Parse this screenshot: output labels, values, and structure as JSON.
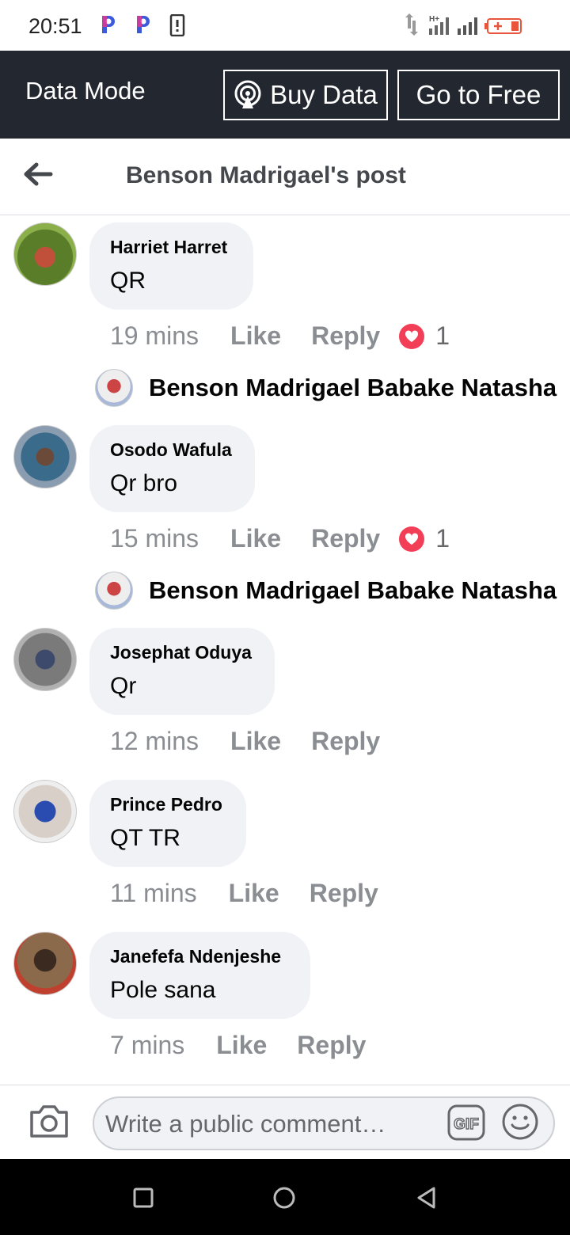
{
  "status_bar": {
    "time": "20:51"
  },
  "data_bar": {
    "label": "Data Mode",
    "buy_label": "Buy Data",
    "free_label": "Go to Free"
  },
  "header": {
    "title": "Benson Madrigael's post"
  },
  "comments": [
    {
      "author": "Harriet Harret",
      "text": "QR",
      "time": "19 mins",
      "like": "Like",
      "reply": "Reply",
      "reactions": "1",
      "reply_author": "Benson Madrigael Babake Natasha"
    },
    {
      "author": "Osodo Wafula",
      "text": "Qr bro",
      "time": "15 mins",
      "like": "Like",
      "reply": "Reply",
      "reactions": "1",
      "reply_author": "Benson Madrigael Babake Natasha"
    },
    {
      "author": "Josephat Oduya",
      "text": "Qr",
      "time": "12 mins",
      "like": "Like",
      "reply": "Reply"
    },
    {
      "author": "Prince Pedro",
      "text": "QT TR",
      "time": "11 mins",
      "like": "Like",
      "reply": "Reply"
    },
    {
      "author": "Janefefa Ndenjeshe",
      "text": "Pole sana",
      "time": "7 mins",
      "like": "Like",
      "reply": "Reply"
    }
  ],
  "composer": {
    "placeholder": "Write a public comment…"
  },
  "colors": {
    "data_bar_bg": "#23272f",
    "heart": "#f33e58",
    "bubble": "#f0f2f5",
    "meta": "#8a8d91"
  },
  "icons": [
    "app-p-icon",
    "phone-icon",
    "signal-icon",
    "battery-icon",
    "broadcast-icon",
    "back-arrow-icon",
    "heart-reaction-icon",
    "camera-icon",
    "gif-icon",
    "smiley-icon",
    "nav-square-icon",
    "nav-circle-icon",
    "nav-back-icon"
  ]
}
